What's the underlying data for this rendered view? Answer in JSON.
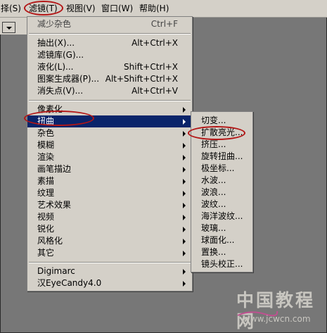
{
  "menubar": {
    "items": [
      "择(S)",
      "滤镜(T)",
      "视图(V)",
      "窗口(W)",
      "帮助(H)"
    ]
  },
  "filter_menu": {
    "top_items": [
      {
        "label": "减少杂色",
        "shortcut": "Ctrl+F"
      }
    ],
    "group1": [
      {
        "label": "抽出(X)...",
        "shortcut": "Alt+Ctrl+X"
      },
      {
        "label": "滤镜库(G)...",
        "shortcut": ""
      },
      {
        "label": "液化(L)...",
        "shortcut": "Shift+Ctrl+X"
      },
      {
        "label": "图案生成器(P)...",
        "shortcut": "Alt+Shift+Ctrl+X"
      },
      {
        "label": "消失点(V)...",
        "shortcut": "Alt+Ctrl+V"
      }
    ],
    "group2": [
      "像素化",
      "扭曲",
      "杂色",
      "模糊",
      "渲染",
      "画笔描边",
      "素描",
      "纹理",
      "艺术效果",
      "视频",
      "锐化",
      "风格化",
      "其它"
    ],
    "group3": [
      "Digimarc",
      "汉EyeCandy4.0"
    ],
    "selected": "扭曲"
  },
  "distort_submenu": {
    "items": [
      "切变...",
      "扩散亮光...",
      "挤压...",
      "旋转扭曲...",
      "极坐标...",
      "水波...",
      "波浪...",
      "波纹...",
      "海洋波纹...",
      "玻璃...",
      "球面化...",
      "置换...",
      "镜头校正..."
    ]
  },
  "watermark": {
    "title": "中国教程网",
    "url": "www.jcwcn.com"
  },
  "colors": {
    "menu_bg": "#d4d0c8",
    "selection": "#0a246a",
    "annotation": "#b31616",
    "canvas": "#777777"
  }
}
